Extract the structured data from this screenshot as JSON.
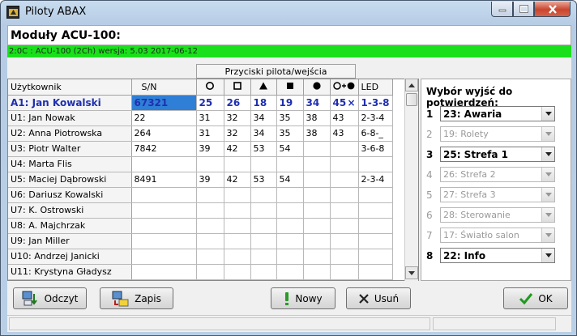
{
  "window": {
    "title": "Piloty ABAX"
  },
  "header": {
    "title": "Moduły ACU-100:",
    "info": "2:0C :  ACU-100  (2Ch) wersja: 5.03 2017-06-12"
  },
  "table": {
    "group_header": "Przyciski pilota/wejścia",
    "columns": [
      "Użytkownik",
      "S/N",
      "",
      "",
      "",
      "",
      "",
      "",
      "LED"
    ],
    "column_icons": [
      "circle-icon",
      "square-outline-icon",
      "triangle-icon",
      "filled-square-icon",
      "filled-circle-icon",
      "circle-plus-circle-icon"
    ],
    "rows": [
      {
        "user": "A1: Jan Kowalski",
        "sn": "67321",
        "b": [
          "25",
          "26",
          "18",
          "19",
          "34",
          "45"
        ],
        "led": "1-3-8",
        "active": true,
        "mark": "×"
      },
      {
        "user": "U1: Jan Nowak",
        "sn": "22",
        "b": [
          "31",
          "32",
          "34",
          "35",
          "38",
          "43"
        ],
        "led": "2-3-4"
      },
      {
        "user": "U2: Anna Piotrowska",
        "sn": "264",
        "b": [
          "31",
          "32",
          "34",
          "35",
          "38",
          "43"
        ],
        "led": "6-8-_"
      },
      {
        "user": "U3: Piotr Walter",
        "sn": "7842",
        "b": [
          "39",
          "42",
          "53",
          "54",
          "",
          ""
        ],
        "led": "3-6-8"
      },
      {
        "user": "U4: Marta Flis",
        "sn": "",
        "b": [
          "",
          "",
          "",
          "",
          "",
          ""
        ],
        "led": ""
      },
      {
        "user": "U5: Maciej Dąbrowski",
        "sn": "8491",
        "b": [
          "39",
          "42",
          "53",
          "54",
          "",
          ""
        ],
        "led": "2-3-4"
      },
      {
        "user": "U6: Dariusz Kowalski",
        "sn": "",
        "b": [
          "",
          "",
          "",
          "",
          "",
          ""
        ],
        "led": ""
      },
      {
        "user": "U7: K. Ostrowski",
        "sn": "",
        "b": [
          "",
          "",
          "",
          "",
          "",
          ""
        ],
        "led": ""
      },
      {
        "user": "U8: A. Majchrzak",
        "sn": "",
        "b": [
          "",
          "",
          "",
          "",
          "",
          ""
        ],
        "led": ""
      },
      {
        "user": "U9: Jan Miller",
        "sn": "",
        "b": [
          "",
          "",
          "",
          "",
          "",
          ""
        ],
        "led": ""
      },
      {
        "user": "U10: Andrzej Janicki",
        "sn": "",
        "b": [
          "",
          "",
          "",
          "",
          "",
          ""
        ],
        "led": ""
      },
      {
        "user": "U11: Krystyna Gładysz",
        "sn": "",
        "b": [
          "",
          "",
          "",
          "",
          "",
          ""
        ],
        "led": ""
      }
    ]
  },
  "outputs": {
    "title": "Wybór wyjść do potwierdzeń:",
    "items": [
      {
        "num": "1",
        "value": "23: Awaria",
        "enabled": true
      },
      {
        "num": "2",
        "value": "19: Rolety",
        "enabled": false
      },
      {
        "num": "3",
        "value": "25: Strefa 1",
        "enabled": true
      },
      {
        "num": "4",
        "value": "26: Strefa 2",
        "enabled": false
      },
      {
        "num": "5",
        "value": "27: Strefa 3",
        "enabled": false
      },
      {
        "num": "6",
        "value": "28: Sterowanie",
        "enabled": false
      },
      {
        "num": "7",
        "value": "17: Światło salon",
        "enabled": false
      },
      {
        "num": "8",
        "value": "22: Info",
        "enabled": true
      }
    ]
  },
  "buttons": {
    "read": "Odczyt",
    "write": "Zapis",
    "new": "Nowy",
    "delete": "Usuń",
    "ok": "OK"
  },
  "colors": {
    "accent_green": "#19e01a",
    "selection_blue": "#2f7fd6",
    "active_text": "#1f2fb0"
  }
}
